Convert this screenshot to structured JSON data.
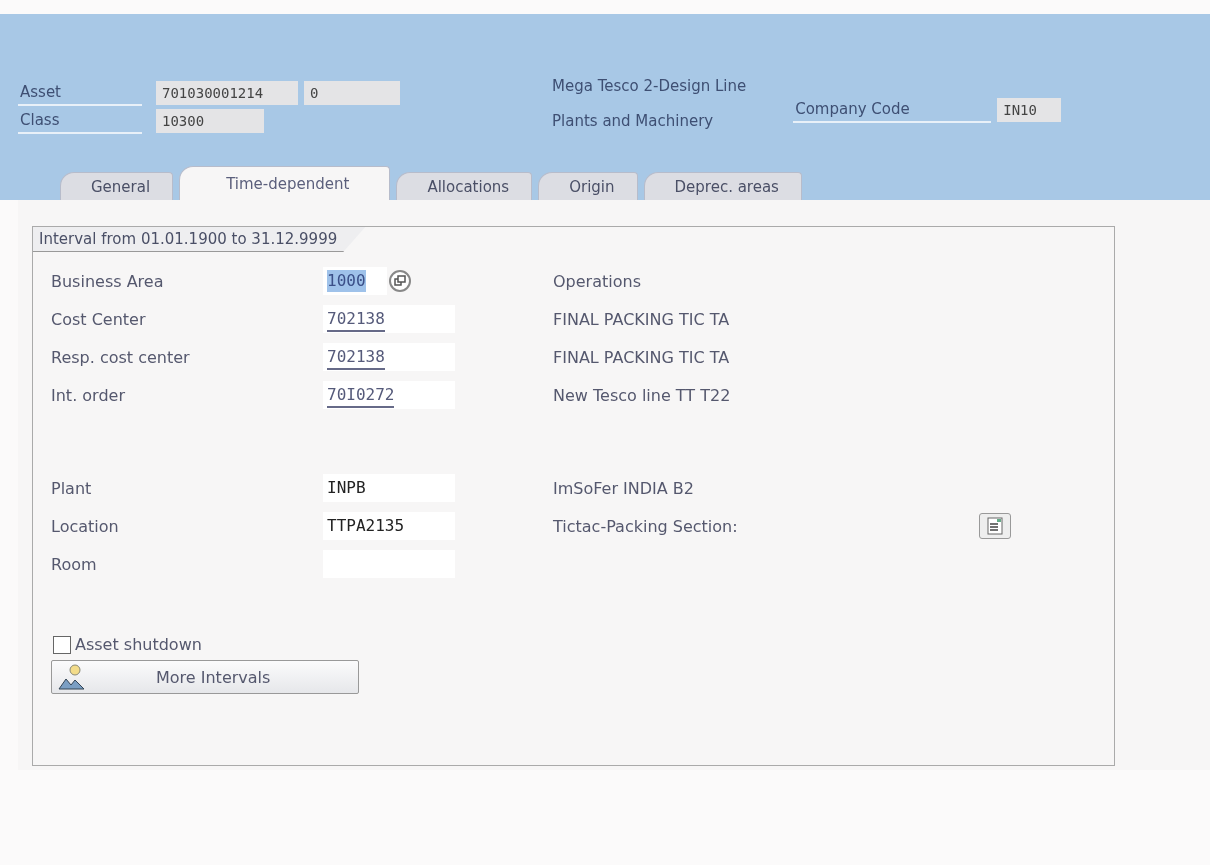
{
  "header": {
    "asset": {
      "label": "Asset",
      "value": "701030001214",
      "subnumber": "0",
      "description": "Mega Tesco 2-Design Line"
    },
    "class": {
      "label": "Class",
      "value": "10300",
      "description": "Plants and Machinery"
    },
    "company_code": {
      "label": "Company Code",
      "value": "IN10"
    }
  },
  "tabs": [
    {
      "label": "General",
      "selected": false
    },
    {
      "label": "Time-dependent",
      "selected": true
    },
    {
      "label": "Allocations",
      "selected": false
    },
    {
      "label": "Origin",
      "selected": false
    },
    {
      "label": "Deprec. areas",
      "selected": false
    }
  ],
  "interval_title": "Interval from 01.01.1900 to 31.12.9999",
  "field_groups": [
    [
      {
        "label": "Business Area",
        "value": "1000",
        "highlighted": true,
        "underlined": false,
        "help_button": true,
        "detail_button": false,
        "description": "Operations"
      },
      {
        "label": "Cost Center",
        "value": "702138",
        "highlighted": false,
        "underlined": true,
        "help_button": false,
        "detail_button": false,
        "description": "FINAL PACKING TIC TA"
      },
      {
        "label": "Resp. cost center",
        "value": "702138",
        "highlighted": false,
        "underlined": true,
        "help_button": false,
        "detail_button": false,
        "description": "FINAL PACKING TIC TA"
      },
      {
        "label": "Int. order",
        "value": "70I0272",
        "highlighted": false,
        "underlined": true,
        "help_button": false,
        "detail_button": false,
        "description": "New Tesco line TT T22"
      }
    ],
    [
      {
        "label": "Plant",
        "value": "INPB",
        "highlighted": false,
        "underlined": false,
        "help_button": false,
        "detail_button": false,
        "description": "ImSoFer INDIA B2"
      },
      {
        "label": "Location",
        "value": "TTPA2135",
        "highlighted": false,
        "underlined": false,
        "help_button": false,
        "detail_button": true,
        "description": "Tictac-Packing Section:"
      },
      {
        "label": "Room",
        "highlighted": false,
        "underlined": false,
        "help_button": false,
        "detail_button": false
      }
    ]
  ],
  "asset_shutdown": {
    "label": "Asset shutdown",
    "checked": false
  },
  "more_intervals_button": {
    "label": "More Intervals"
  }
}
